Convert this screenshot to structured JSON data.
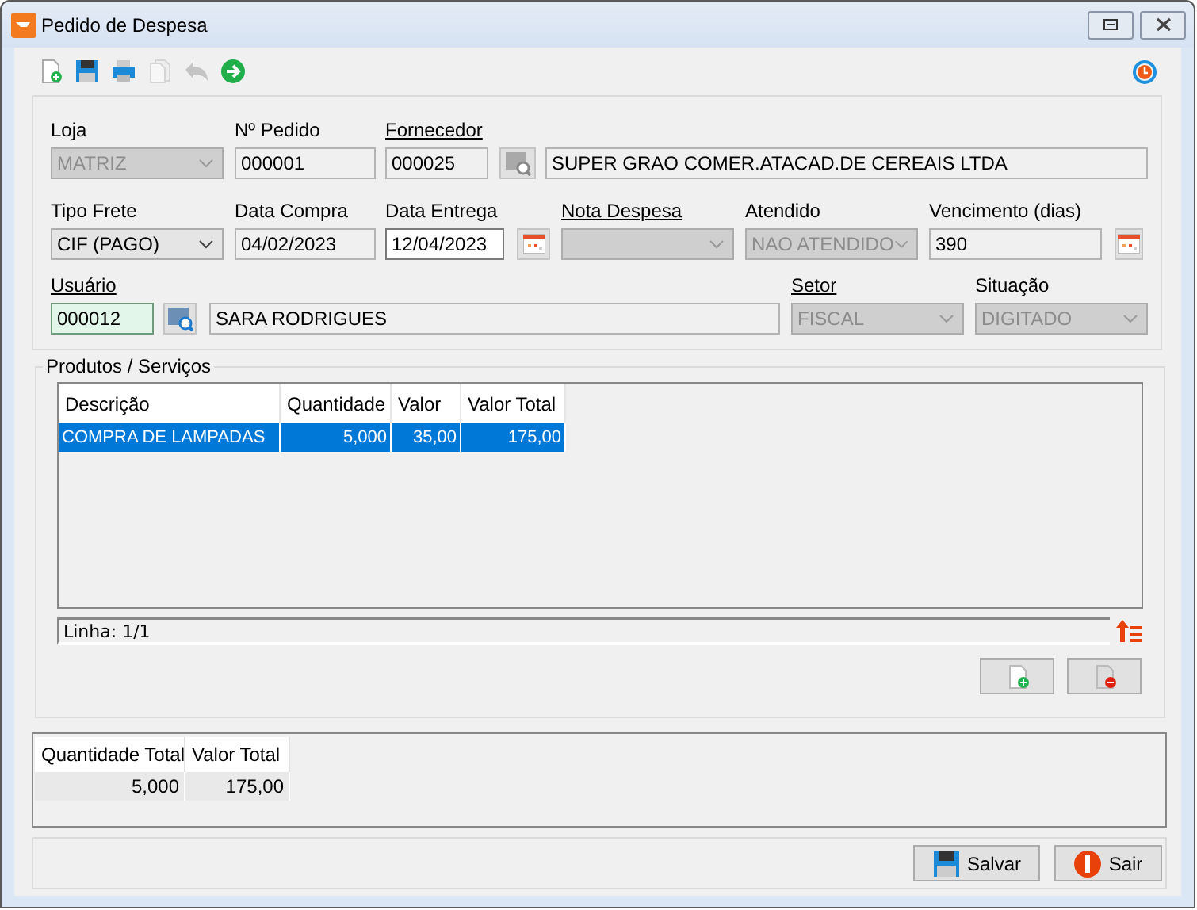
{
  "window": {
    "title": "Pedido de Despesa"
  },
  "toolbar": [
    {
      "kind": "new",
      "disabled": false
    },
    {
      "kind": "save",
      "disabled": false
    },
    {
      "kind": "print",
      "disabled": false
    },
    {
      "kind": "copy",
      "disabled": true
    },
    {
      "kind": "undo",
      "disabled": true
    },
    {
      "kind": "next",
      "disabled": false
    }
  ],
  "form": {
    "fields": [
      {
        "label": "Loja",
        "link": false,
        "controls": [
          {
            "kind": "combo",
            "value": "MATRIZ",
            "disabled": true
          }
        ]
      },
      {
        "label": "Nº Pedido",
        "link": false,
        "controls": [
          {
            "kind": "text",
            "value": "000001",
            "readonly": true,
            "highlighted": false
          }
        ]
      },
      {
        "label": "Fornecedor",
        "link": true,
        "controls": [
          {
            "kind": "text",
            "value": "000025",
            "readonly": true,
            "highlighted": false
          },
          {
            "kind": "search",
            "disabled": true
          },
          {
            "kind": "text",
            "value": "SUPER GRAO COMER.ATACAD.DE CEREAIS LTDA",
            "readonly": true,
            "highlighted": false
          }
        ]
      },
      {
        "label": "Tipo Frete",
        "link": false,
        "controls": [
          {
            "kind": "combo",
            "value": "CIF (PAGO)",
            "disabled": false
          }
        ]
      },
      {
        "label": "Data Compra",
        "link": false,
        "controls": [
          {
            "kind": "text",
            "value": "04/02/2023",
            "readonly": true,
            "highlighted": false
          }
        ]
      },
      {
        "label": "Data Entrega",
        "link": false,
        "controls": [
          {
            "kind": "text",
            "value": "12/04/2023",
            "readonly": false,
            "highlighted": false
          },
          {
            "kind": "calendar"
          }
        ]
      },
      {
        "label": "Nota Despesa",
        "link": true,
        "controls": [
          {
            "kind": "combo",
            "disabled": true
          }
        ]
      },
      {
        "label": "Atendido",
        "link": false,
        "controls": [
          {
            "kind": "combo",
            "value": "NAO ATENDIDO",
            "disabled": true
          }
        ]
      },
      {
        "label": "Vencimento (dias)",
        "link": false,
        "controls": [
          {
            "kind": "text",
            "value": "390",
            "readonly": true,
            "highlighted": false
          },
          {
            "kind": "calendar"
          }
        ]
      },
      {
        "label": "Usuário",
        "link": true,
        "controls": [
          {
            "kind": "text",
            "value": "000012",
            "readonly": false,
            "highlighted": true
          },
          {
            "kind": "search",
            "disabled": false
          },
          {
            "kind": "text",
            "value": "SARA RODRIGUES",
            "readonly": true,
            "highlighted": false
          }
        ]
      },
      {
        "label": "Setor",
        "link": true,
        "controls": [
          {
            "kind": "combo",
            "value": "FISCAL",
            "disabled": true
          }
        ]
      },
      {
        "label": "Situação",
        "link": false,
        "controls": [
          {
            "kind": "combo",
            "value": "DIGITADO",
            "disabled": true
          }
        ]
      }
    ]
  },
  "products": {
    "title": "Produtos / Serviços",
    "columns": [
      "Descrição",
      "Quantidade",
      "Valor",
      "Valor Total"
    ],
    "rows": [
      {
        "cells": [
          "COMPRA DE LAMPADAS",
          "5,000",
          "35,00",
          "175,00"
        ],
        "selected": true
      }
    ],
    "position": "Linha: 1/1"
  },
  "totals": {
    "columns": [
      "Quantidade Total",
      "Valor Total"
    ],
    "values": [
      "5,000",
      "175,00"
    ]
  },
  "buttons": [
    {
      "kind": "save",
      "label": "Salvar"
    },
    {
      "kind": "exit",
      "label": "Sair"
    }
  ]
}
